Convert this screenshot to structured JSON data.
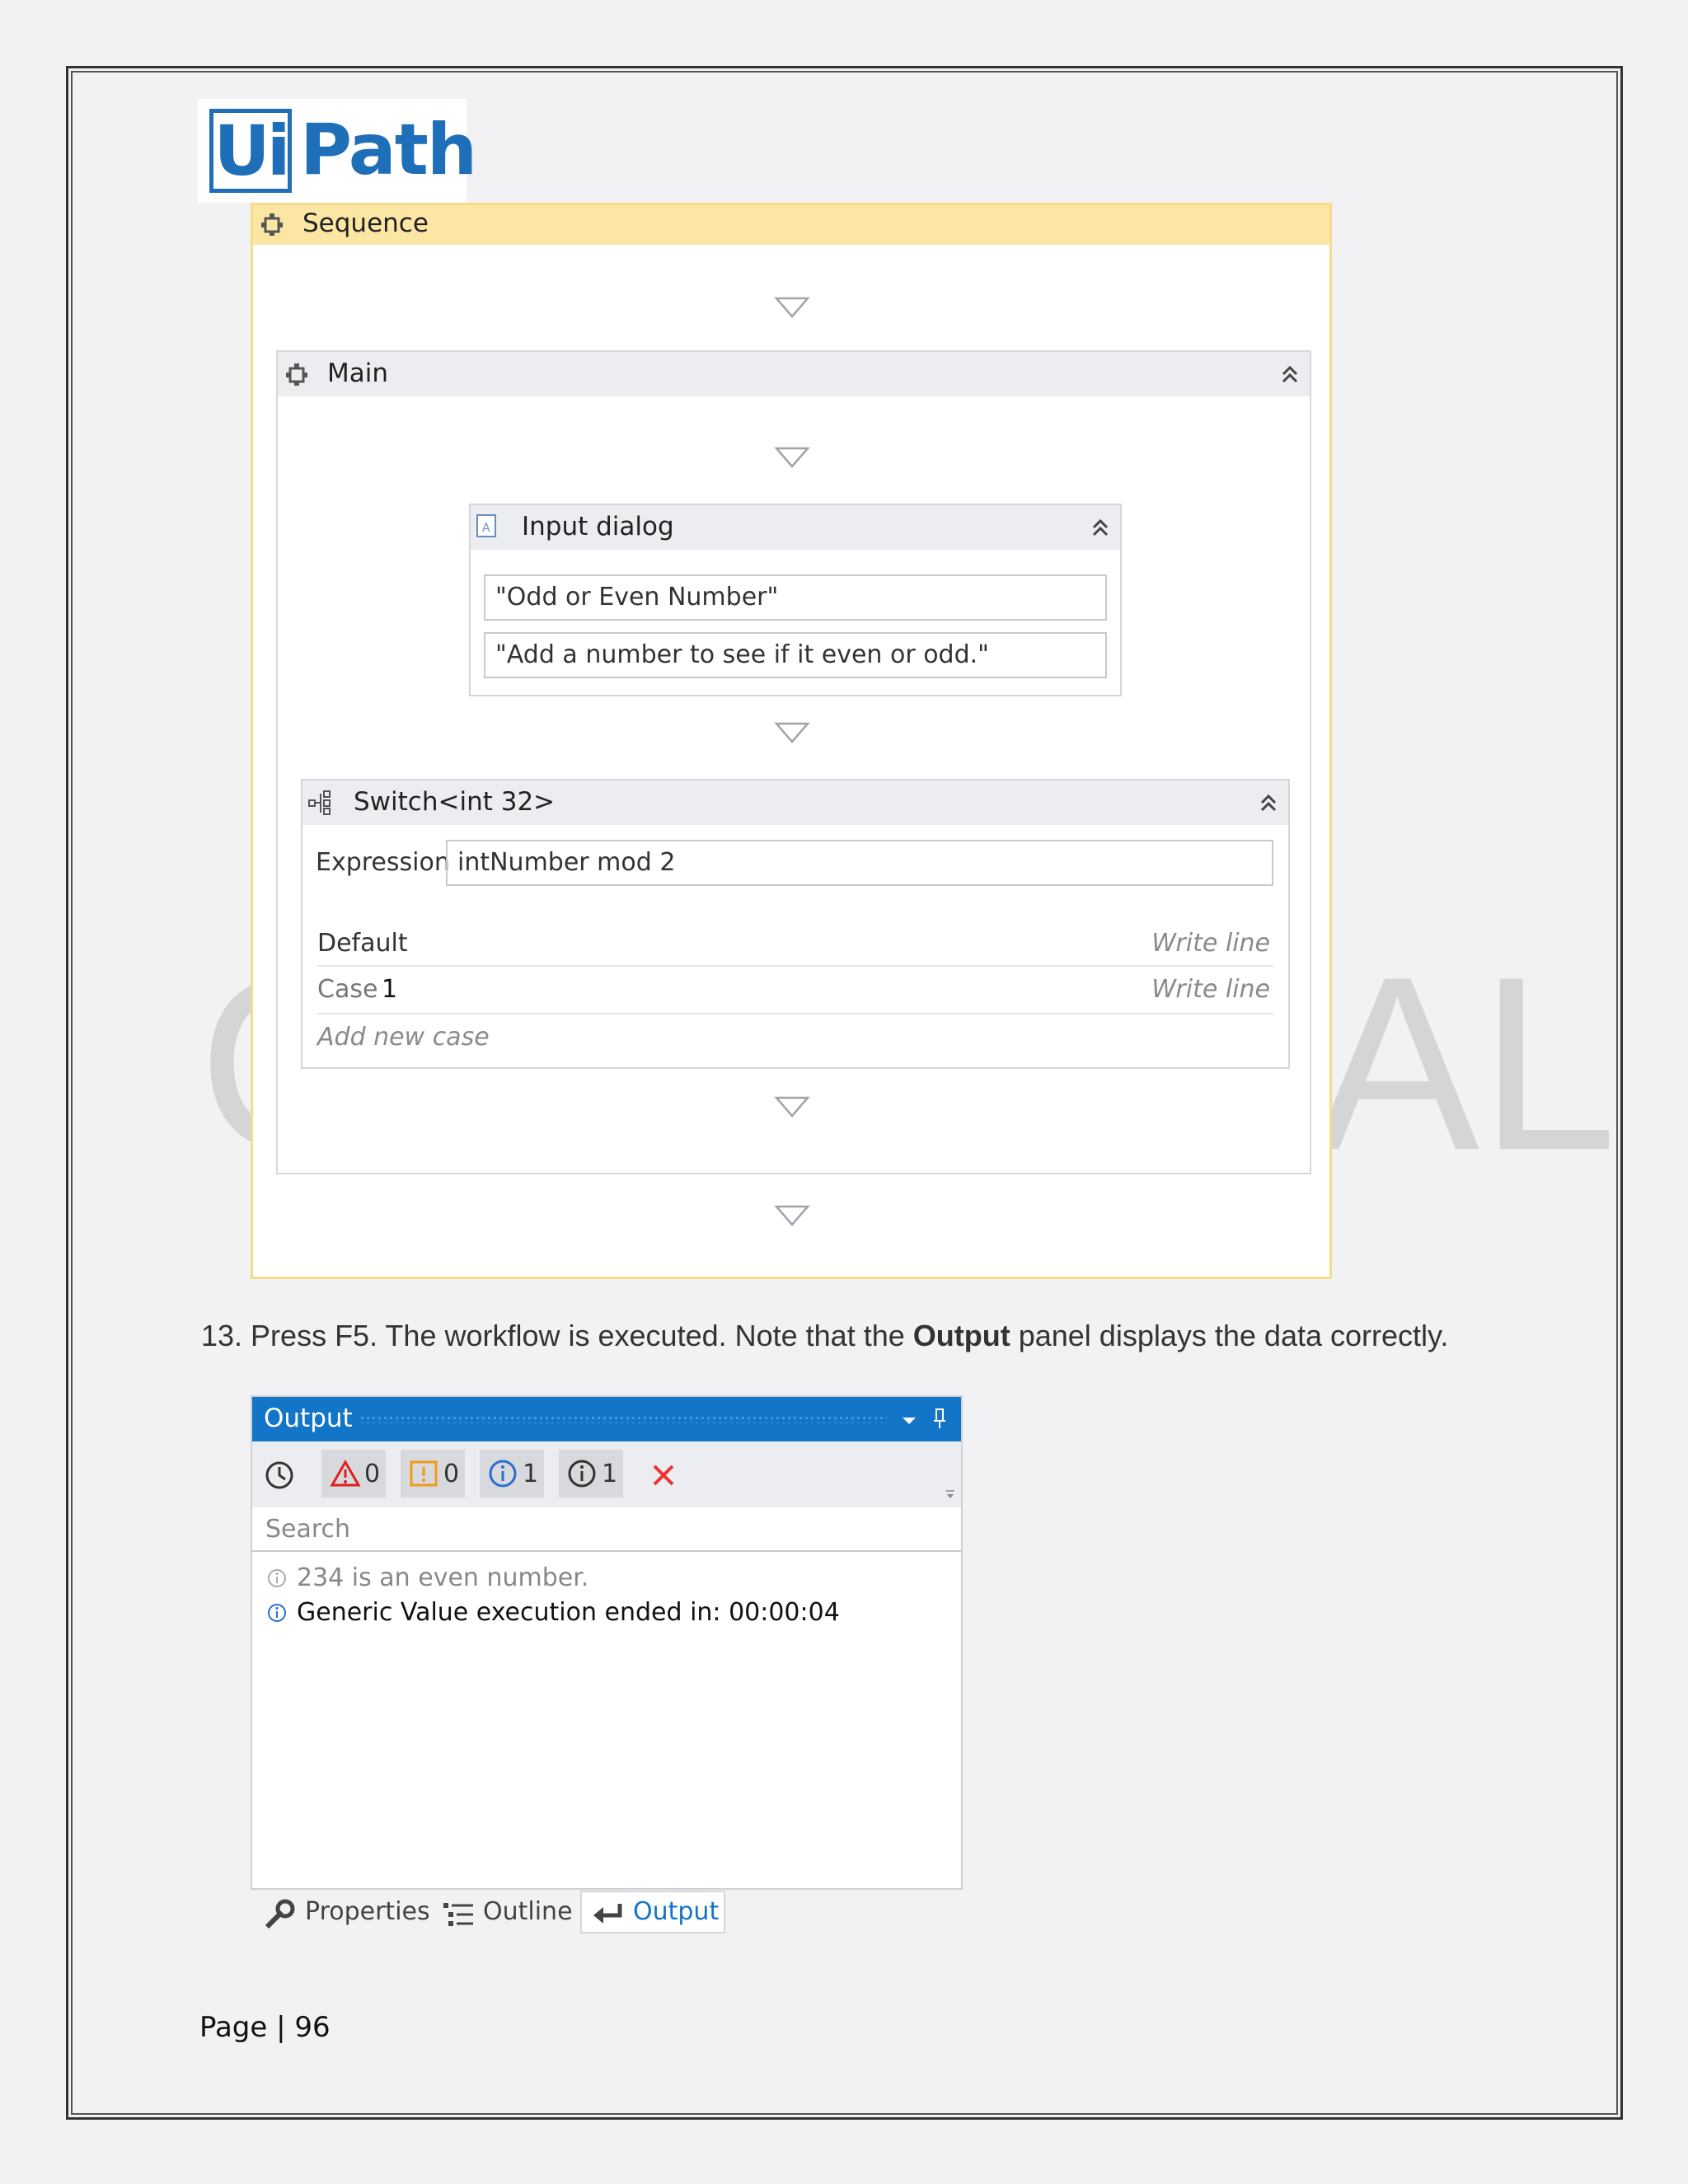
{
  "logo": {
    "ui": "Ui",
    "path": "Path"
  },
  "watermark": {
    "left": "C",
    "right": "AL"
  },
  "workflow": {
    "sequence_title": "Sequence",
    "main_title": "Main",
    "input_dialog": {
      "title": "Input dialog",
      "dialog_title": "\"Odd or Even Number\"",
      "label": "\"Add a number to see if it even or odd.\""
    },
    "switch": {
      "title": "Switch<int 32>",
      "expression_label": "Expression",
      "expression_value": "intNumber mod 2",
      "default_label": "Default",
      "default_action": "Write line",
      "case_label": "Case",
      "case_value": "1",
      "case_action": "Write line",
      "add_case": "Add new case"
    }
  },
  "instruction": {
    "prefix": "13. Press F5. The workflow is executed. Note that the ",
    "bold": "Output",
    "suffix": " panel displays the data correctly."
  },
  "output_panel": {
    "title": "Output",
    "counts": {
      "errors": "0",
      "warnings": "0",
      "info": "1",
      "trace": "1"
    },
    "search_placeholder": "Search",
    "messages": [
      "234 is an even number.",
      "Generic Value execution ended in: 00:00:04"
    ],
    "tabs": [
      "Properties",
      "Outline",
      "Output"
    ],
    "active_tab": "Output"
  },
  "footer": {
    "page_label": "Page | 96"
  },
  "colors": {
    "accent": "#1275c8",
    "sequence_border": "#f6dc8a",
    "sequence_header": "#fce6a4",
    "logo": "#1f6fb8"
  }
}
